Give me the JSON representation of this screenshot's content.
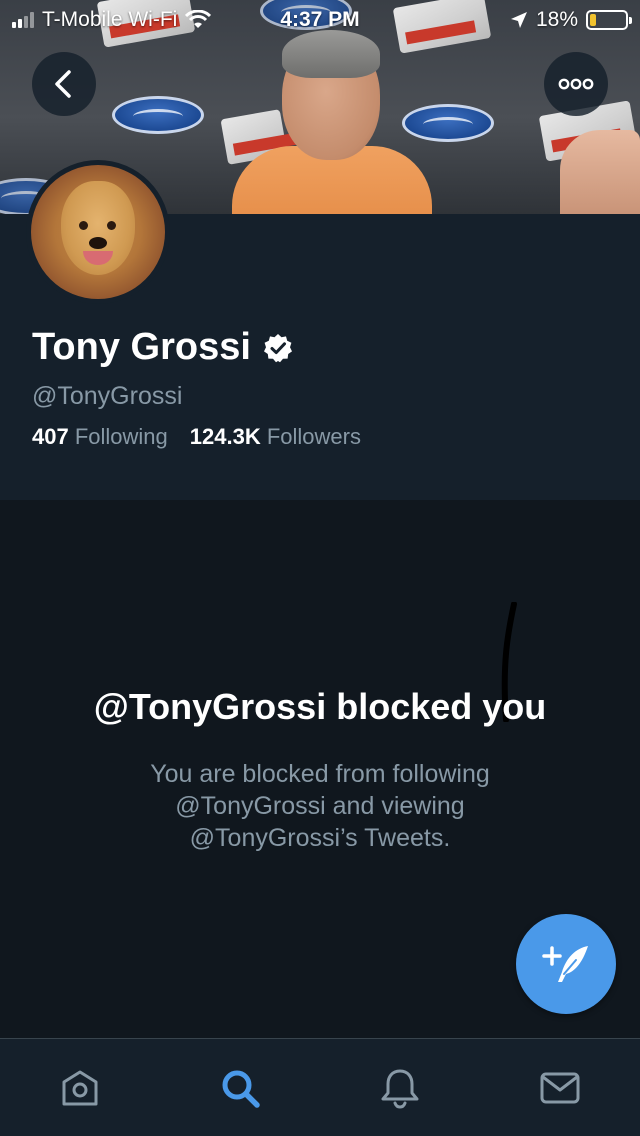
{
  "status_bar": {
    "carrier": "T-Mobile Wi-Fi",
    "time": "4:37 PM",
    "battery_percent": "18%",
    "battery_level": 0.18,
    "battery_color": "#f2c32e"
  },
  "header": {
    "back_icon": "chevron-left-icon",
    "more_icon": "ellipsis-icon"
  },
  "profile": {
    "name": "Tony Grossi",
    "verified_icon": "verified-badge-icon",
    "handle": "@TonyGrossi",
    "following_count": "407",
    "following_label": "Following",
    "followers_count": "124.3K",
    "followers_label": "Followers"
  },
  "blocked": {
    "title": "@TonyGrossi blocked you",
    "description": "You are blocked from following @TonyGrossi and viewing @TonyGrossi’s Tweets."
  },
  "fab": {
    "icon": "compose-tweet-icon",
    "color": "#4a99e9"
  },
  "tabbar": {
    "tabs": [
      {
        "icon": "home-icon",
        "active": false
      },
      {
        "icon": "search-icon",
        "active": true
      },
      {
        "icon": "notifications-bell-icon",
        "active": false
      },
      {
        "icon": "messages-envelope-icon",
        "active": false
      }
    ],
    "active_color": "#4a99e9",
    "inactive_color": "#8899a6"
  },
  "colors": {
    "background": "#15202b",
    "blocked_background": "#10171e",
    "secondary_text": "#8899a6"
  }
}
